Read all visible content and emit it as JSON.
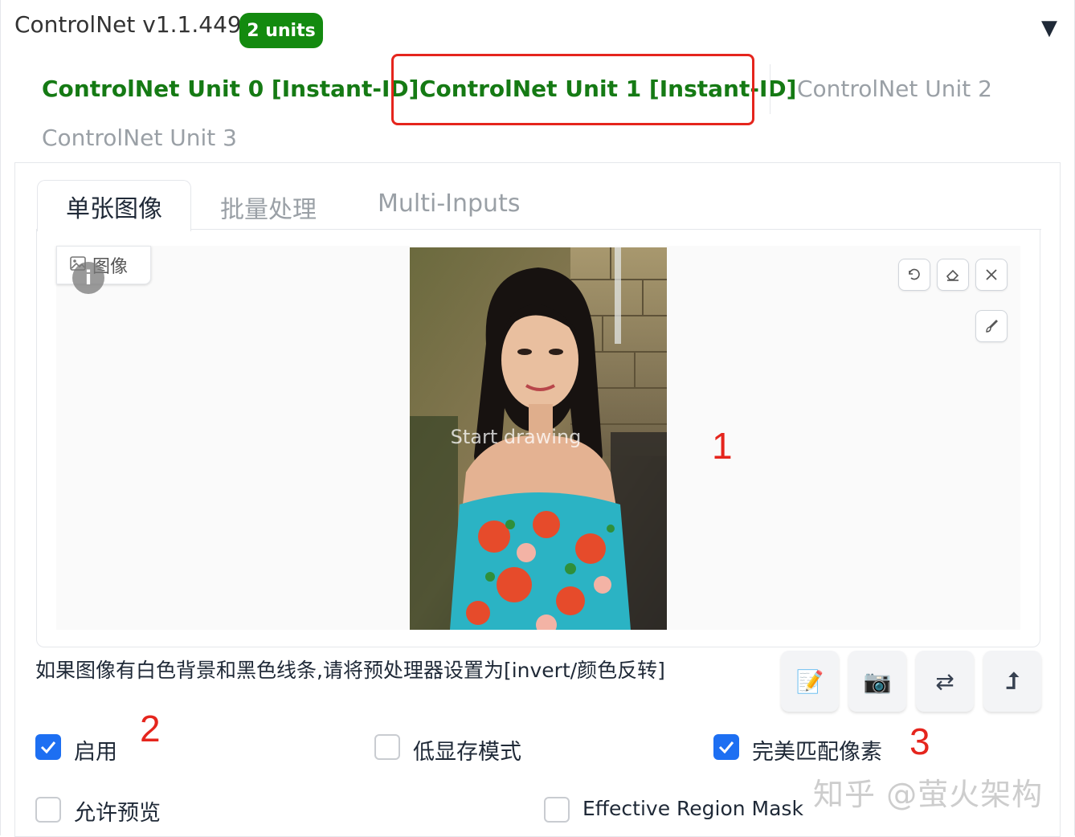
{
  "header": {
    "title": "ControlNet v1.1.449",
    "badge": "2 units",
    "collapse_icon": "▼"
  },
  "unit_tabs": [
    {
      "label": "ControlNet Unit 0 [Instant-ID]",
      "state": "enabled"
    },
    {
      "label": "ControlNet Unit 1 [Instant-ID]",
      "state": "selected"
    },
    {
      "label": "ControlNet Unit 2",
      "state": "disabled"
    },
    {
      "label": "ControlNet Unit 3",
      "state": "disabled"
    }
  ],
  "input_tabs": [
    {
      "label": "单张图像",
      "active": true
    },
    {
      "label": "批量处理",
      "active": false
    },
    {
      "label": "Multi-Inputs",
      "active": false
    }
  ],
  "image_panel": {
    "label": "图像",
    "info_glyph": "i",
    "placeholder": "Start drawing",
    "tools": [
      "undo-icon",
      "eraser-icon",
      "close-icon",
      "brush-icon"
    ]
  },
  "hint": "如果图像有白色背景和黑色线条,请将预处理器设置为[invert/颜色反转]",
  "action_buttons": [
    {
      "icon": "memo-icon",
      "glyph": "📝"
    },
    {
      "icon": "camera-icon",
      "glyph": "📷"
    },
    {
      "icon": "swap-icon",
      "glyph": "⇄"
    },
    {
      "icon": "upload-arrow-icon",
      "glyph": "⮥"
    }
  ],
  "checkboxes": [
    {
      "label": "启用",
      "checked": true
    },
    {
      "label": "低显存模式",
      "checked": false
    },
    {
      "label": "完美匹配像素",
      "checked": true
    },
    {
      "label": "允许预览",
      "checked": false
    },
    {
      "label": "Effective Region Mask",
      "checked": false
    }
  ],
  "annotations": [
    "1",
    "2",
    "3"
  ],
  "watermark": "知乎 @萤火架构",
  "colors": {
    "accent_green": "#138a0f",
    "tab_green": "#157a14",
    "highlight_red": "#e5251d",
    "checkbox_blue": "#1d6ff2"
  }
}
